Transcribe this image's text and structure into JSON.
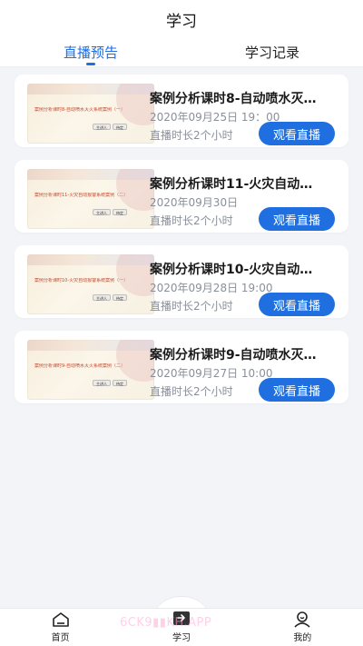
{
  "header": {
    "title": "学习"
  },
  "tabs": [
    {
      "label": "直播预告",
      "active": true
    },
    {
      "label": "学习记录",
      "active": false
    }
  ],
  "courses": [
    {
      "title": "案例分析课时8-自动喷水灭…",
      "date": "2020年09月25日 19：00",
      "duration": "直播时长2个小时",
      "button": "观看直播",
      "thumb_text": "案例分析课时8-自动喷水灭火系统案例（一）",
      "thumb_tags": [
        "主讲人",
        "待定"
      ]
    },
    {
      "title": "案例分析课时11-火灾自动…",
      "date": "2020年09月30日",
      "duration": "直播时长2个小时",
      "button": "观看直播",
      "thumb_text": "案例分析课时11-火灾自动报警系统案例（二）",
      "thumb_tags": [
        "主讲人",
        "待定"
      ]
    },
    {
      "title": "案例分析课时10-火灾自动…",
      "date": "2020年09月28日 19:00",
      "duration": "直播时长2个小时",
      "button": "观看直播",
      "thumb_text": "案例分析课时10-火灾自动报警系统案例（一）",
      "thumb_tags": [
        "主讲人",
        "待定"
      ]
    },
    {
      "title": "案例分析课时9-自动喷水灭…",
      "date": "2020年09月27日 10:00",
      "duration": "直播时长2个小时",
      "button": "观看直播",
      "thumb_text": "案例分析课时9-自动喷水灭火系统案例（二）",
      "thumb_tags": [
        "主讲人",
        "待定"
      ]
    }
  ],
  "tabbar": [
    {
      "label": "首页",
      "icon": "home-icon"
    },
    {
      "label": "学习",
      "icon": "study-icon"
    },
    {
      "label": "我的",
      "icon": "profile-icon"
    }
  ],
  "watermark": "6CK9▮▮KH.APP",
  "colors": {
    "accent": "#1f6fe0",
    "background": "#f2f4f8",
    "muted_text": "#8a8f99"
  }
}
